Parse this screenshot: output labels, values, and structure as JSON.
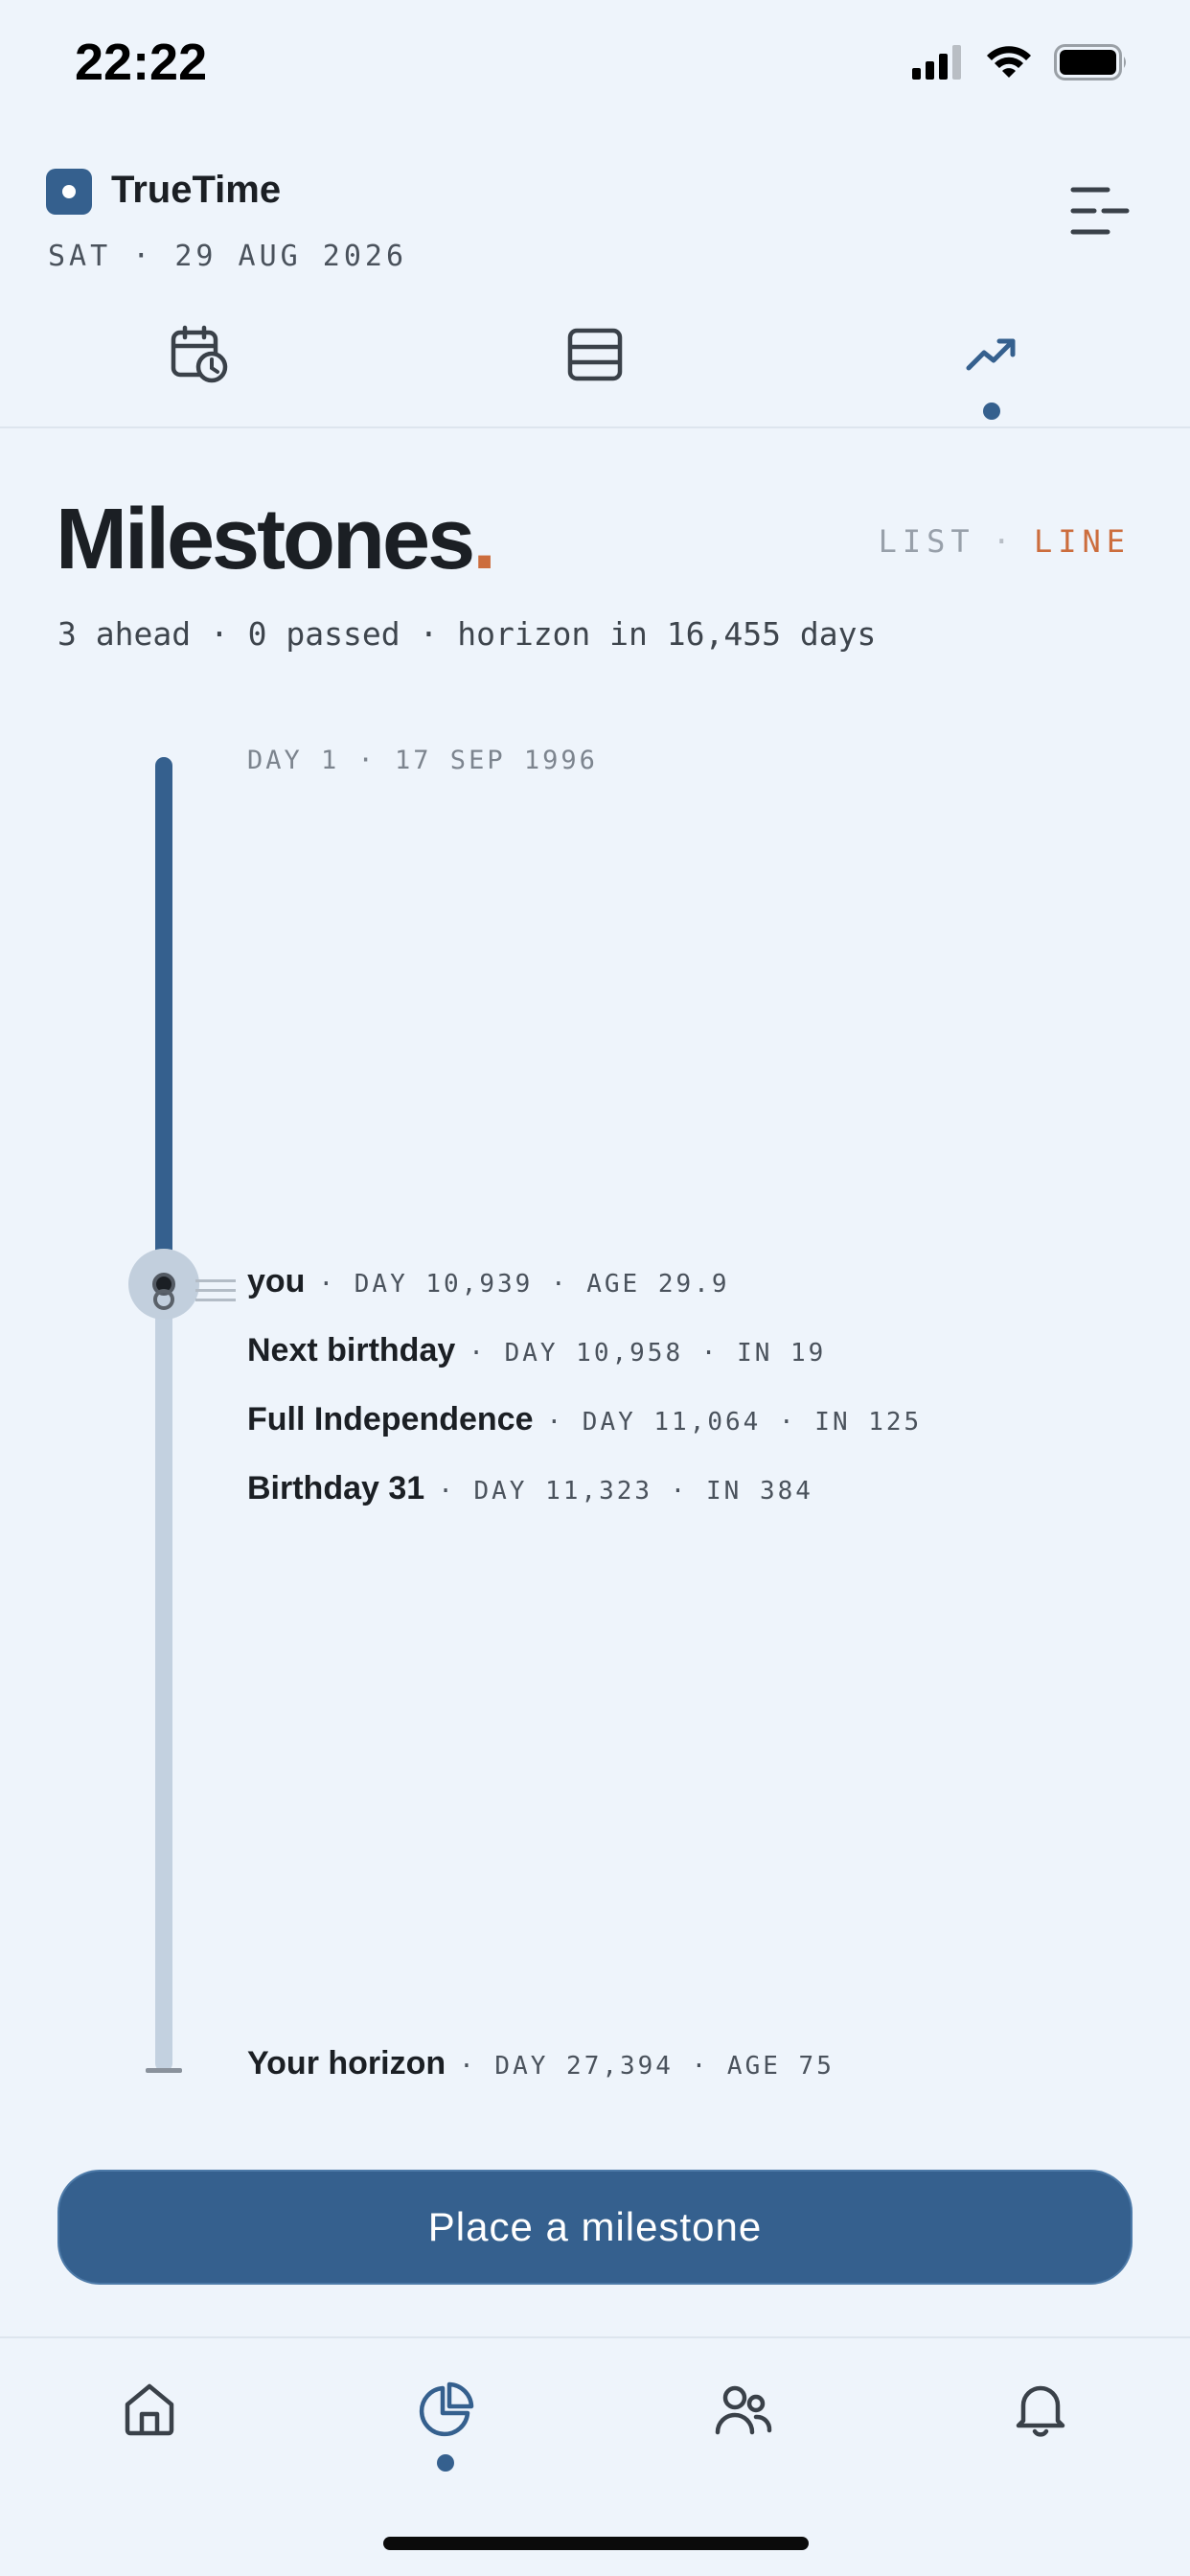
{
  "status_bar": {
    "time": "22:22"
  },
  "header": {
    "app_name": "TrueTime",
    "date": "SAT · 29 AUG 2026"
  },
  "top_tabs": [
    {
      "icon": "calendar-clock-icon",
      "active": false
    },
    {
      "icon": "list-view-icon",
      "active": false
    },
    {
      "icon": "trending-up-icon",
      "active": true
    }
  ],
  "milestones": {
    "title": "Milestones",
    "title_dot": ".",
    "view_toggle": {
      "list": "LIST",
      "separator": "·",
      "line": "LINE",
      "active": "LINE"
    },
    "summary": "3 ahead · 0 passed · horizon in 16,455 days"
  },
  "timeline": {
    "start_label": "DAY 1 · 17 SEP 1996",
    "progress_fraction": 0.399,
    "entries": [
      {
        "name": "you",
        "meta": "· DAY 10,939 · AGE 29.9"
      },
      {
        "name": "Next birthday",
        "meta": "· DAY 10,958 · IN 19"
      },
      {
        "name": "Full Independence",
        "meta": "· DAY 11,064 · IN 125"
      },
      {
        "name": "Birthday 31",
        "meta": "· DAY 11,323 · IN 384"
      },
      {
        "name": "Your horizon",
        "meta": "· DAY 27,394 · AGE 75"
      }
    ]
  },
  "cta": {
    "label": "Place a milestone"
  },
  "bottom_nav": [
    {
      "icon": "home-icon",
      "active": false
    },
    {
      "icon": "pie-chart-icon",
      "active": true
    },
    {
      "icon": "people-icon",
      "active": false
    },
    {
      "icon": "bell-icon",
      "active": false
    }
  ],
  "colors": {
    "accent": "#35608e",
    "highlight": "#cc6d3d",
    "background": "#eef4fb"
  }
}
